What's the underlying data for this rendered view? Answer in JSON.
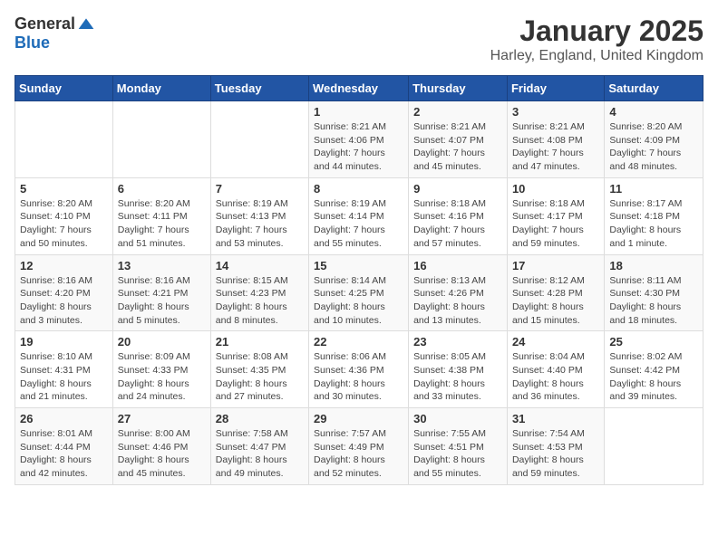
{
  "logo": {
    "general": "General",
    "blue": "Blue"
  },
  "title": "January 2025",
  "location": "Harley, England, United Kingdom",
  "days_header": [
    "Sunday",
    "Monday",
    "Tuesday",
    "Wednesday",
    "Thursday",
    "Friday",
    "Saturday"
  ],
  "weeks": [
    [
      {
        "day": "",
        "info": ""
      },
      {
        "day": "",
        "info": ""
      },
      {
        "day": "",
        "info": ""
      },
      {
        "day": "1",
        "info": "Sunrise: 8:21 AM\nSunset: 4:06 PM\nDaylight: 7 hours\nand 44 minutes."
      },
      {
        "day": "2",
        "info": "Sunrise: 8:21 AM\nSunset: 4:07 PM\nDaylight: 7 hours\nand 45 minutes."
      },
      {
        "day": "3",
        "info": "Sunrise: 8:21 AM\nSunset: 4:08 PM\nDaylight: 7 hours\nand 47 minutes."
      },
      {
        "day": "4",
        "info": "Sunrise: 8:20 AM\nSunset: 4:09 PM\nDaylight: 7 hours\nand 48 minutes."
      }
    ],
    [
      {
        "day": "5",
        "info": "Sunrise: 8:20 AM\nSunset: 4:10 PM\nDaylight: 7 hours\nand 50 minutes."
      },
      {
        "day": "6",
        "info": "Sunrise: 8:20 AM\nSunset: 4:11 PM\nDaylight: 7 hours\nand 51 minutes."
      },
      {
        "day": "7",
        "info": "Sunrise: 8:19 AM\nSunset: 4:13 PM\nDaylight: 7 hours\nand 53 minutes."
      },
      {
        "day": "8",
        "info": "Sunrise: 8:19 AM\nSunset: 4:14 PM\nDaylight: 7 hours\nand 55 minutes."
      },
      {
        "day": "9",
        "info": "Sunrise: 8:18 AM\nSunset: 4:16 PM\nDaylight: 7 hours\nand 57 minutes."
      },
      {
        "day": "10",
        "info": "Sunrise: 8:18 AM\nSunset: 4:17 PM\nDaylight: 7 hours\nand 59 minutes."
      },
      {
        "day": "11",
        "info": "Sunrise: 8:17 AM\nSunset: 4:18 PM\nDaylight: 8 hours\nand 1 minute."
      }
    ],
    [
      {
        "day": "12",
        "info": "Sunrise: 8:16 AM\nSunset: 4:20 PM\nDaylight: 8 hours\nand 3 minutes."
      },
      {
        "day": "13",
        "info": "Sunrise: 8:16 AM\nSunset: 4:21 PM\nDaylight: 8 hours\nand 5 minutes."
      },
      {
        "day": "14",
        "info": "Sunrise: 8:15 AM\nSunset: 4:23 PM\nDaylight: 8 hours\nand 8 minutes."
      },
      {
        "day": "15",
        "info": "Sunrise: 8:14 AM\nSunset: 4:25 PM\nDaylight: 8 hours\nand 10 minutes."
      },
      {
        "day": "16",
        "info": "Sunrise: 8:13 AM\nSunset: 4:26 PM\nDaylight: 8 hours\nand 13 minutes."
      },
      {
        "day": "17",
        "info": "Sunrise: 8:12 AM\nSunset: 4:28 PM\nDaylight: 8 hours\nand 15 minutes."
      },
      {
        "day": "18",
        "info": "Sunrise: 8:11 AM\nSunset: 4:30 PM\nDaylight: 8 hours\nand 18 minutes."
      }
    ],
    [
      {
        "day": "19",
        "info": "Sunrise: 8:10 AM\nSunset: 4:31 PM\nDaylight: 8 hours\nand 21 minutes."
      },
      {
        "day": "20",
        "info": "Sunrise: 8:09 AM\nSunset: 4:33 PM\nDaylight: 8 hours\nand 24 minutes."
      },
      {
        "day": "21",
        "info": "Sunrise: 8:08 AM\nSunset: 4:35 PM\nDaylight: 8 hours\nand 27 minutes."
      },
      {
        "day": "22",
        "info": "Sunrise: 8:06 AM\nSunset: 4:36 PM\nDaylight: 8 hours\nand 30 minutes."
      },
      {
        "day": "23",
        "info": "Sunrise: 8:05 AM\nSunset: 4:38 PM\nDaylight: 8 hours\nand 33 minutes."
      },
      {
        "day": "24",
        "info": "Sunrise: 8:04 AM\nSunset: 4:40 PM\nDaylight: 8 hours\nand 36 minutes."
      },
      {
        "day": "25",
        "info": "Sunrise: 8:02 AM\nSunset: 4:42 PM\nDaylight: 8 hours\nand 39 minutes."
      }
    ],
    [
      {
        "day": "26",
        "info": "Sunrise: 8:01 AM\nSunset: 4:44 PM\nDaylight: 8 hours\nand 42 minutes."
      },
      {
        "day": "27",
        "info": "Sunrise: 8:00 AM\nSunset: 4:46 PM\nDaylight: 8 hours\nand 45 minutes."
      },
      {
        "day": "28",
        "info": "Sunrise: 7:58 AM\nSunset: 4:47 PM\nDaylight: 8 hours\nand 49 minutes."
      },
      {
        "day": "29",
        "info": "Sunrise: 7:57 AM\nSunset: 4:49 PM\nDaylight: 8 hours\nand 52 minutes."
      },
      {
        "day": "30",
        "info": "Sunrise: 7:55 AM\nSunset: 4:51 PM\nDaylight: 8 hours\nand 55 minutes."
      },
      {
        "day": "31",
        "info": "Sunrise: 7:54 AM\nSunset: 4:53 PM\nDaylight: 8 hours\nand 59 minutes."
      },
      {
        "day": "",
        "info": ""
      }
    ]
  ]
}
